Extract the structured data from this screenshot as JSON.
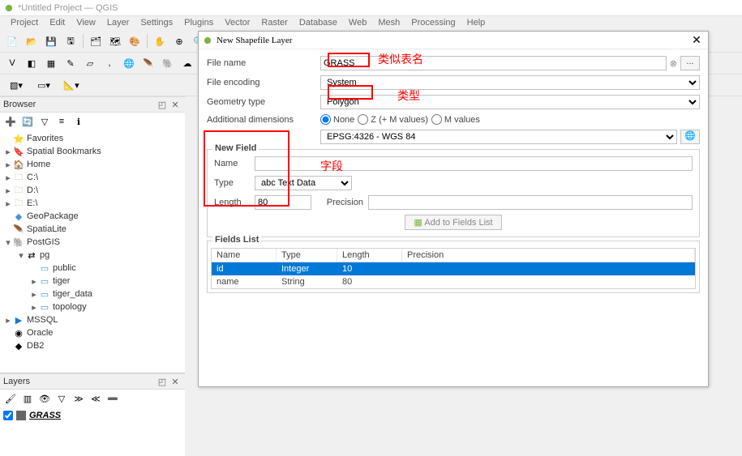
{
  "window_title": "*Untitled Project — QGIS",
  "menus": [
    "Project",
    "Edit",
    "View",
    "Layer",
    "Settings",
    "Plugins",
    "Vector",
    "Raster",
    "Database",
    "Web",
    "Mesh",
    "Processing",
    "Help"
  ],
  "browser": {
    "title": "Browser",
    "items": [
      {
        "indent": 0,
        "exp": "",
        "icon": "⭐",
        "cls": "ic-star",
        "label": "Favorites"
      },
      {
        "indent": 0,
        "exp": "▸",
        "icon": "🔖",
        "cls": "ic-book",
        "label": "Spatial Bookmarks"
      },
      {
        "indent": 0,
        "exp": "▸",
        "icon": "🏠",
        "cls": "",
        "label": "Home"
      },
      {
        "indent": 0,
        "exp": "▸",
        "icon": "🗀",
        "cls": "ic-folder",
        "label": "C:\\"
      },
      {
        "indent": 0,
        "exp": "▸",
        "icon": "🗀",
        "cls": "ic-folder",
        "label": "D:\\"
      },
      {
        "indent": 0,
        "exp": "▸",
        "icon": "🗀",
        "cls": "ic-folder",
        "label": "E:\\"
      },
      {
        "indent": 0,
        "exp": "",
        "icon": "◆",
        "cls": "ic-db",
        "label": "GeoPackage"
      },
      {
        "indent": 0,
        "exp": "",
        "icon": "🪶",
        "cls": "",
        "label": "SpatiaLite"
      },
      {
        "indent": 0,
        "exp": "▾",
        "icon": "🐘",
        "cls": "ic-pg",
        "label": "PostGIS"
      },
      {
        "indent": 1,
        "exp": "▾",
        "icon": "⇄",
        "cls": "",
        "label": "pg"
      },
      {
        "indent": 2,
        "exp": "",
        "icon": "▭",
        "cls": "ic-tbl",
        "label": "public"
      },
      {
        "indent": 2,
        "exp": "▸",
        "icon": "▭",
        "cls": "ic-tbl",
        "label": "tiger"
      },
      {
        "indent": 2,
        "exp": "▸",
        "icon": "▭",
        "cls": "ic-tbl",
        "label": "tiger_data"
      },
      {
        "indent": 2,
        "exp": "▸",
        "icon": "▭",
        "cls": "ic-tbl",
        "label": "topology"
      },
      {
        "indent": 0,
        "exp": "▸",
        "icon": "▶",
        "cls": "ic-mssql",
        "label": "MSSQL"
      },
      {
        "indent": 0,
        "exp": "",
        "icon": "◉",
        "cls": "",
        "label": "Oracle"
      },
      {
        "indent": 0,
        "exp": "",
        "icon": "◆",
        "cls": "",
        "label": "DB2"
      }
    ]
  },
  "layers": {
    "title": "Layers",
    "items": [
      {
        "checked": true,
        "name": "GRASS"
      }
    ]
  },
  "dialog": {
    "title": "New Shapefile Layer",
    "file_name_label": "File name",
    "file_name_value": "GRASS",
    "file_encoding_label": "File encoding",
    "file_encoding_value": "System",
    "geometry_type_label": "Geometry type",
    "geometry_type_value": "Polygon",
    "additional_dim_label": "Additional dimensions",
    "dim_none": "None",
    "dim_zm": "Z (+ M values)",
    "dim_m": "M values",
    "crs_value": "EPSG:4326 - WGS 84",
    "new_field": {
      "legend": "New Field",
      "name_label": "Name",
      "name_value": "",
      "type_label": "Type",
      "type_value": "abc Text Data",
      "length_label": "Length",
      "length_value": "80",
      "precision_label": "Precision",
      "precision_value": ""
    },
    "add_btn": "Add to Fields List",
    "fields_list": {
      "legend": "Fields List",
      "columns": [
        "Name",
        "Type",
        "Length",
        "Precision"
      ],
      "rows": [
        {
          "name": "id",
          "type": "Integer",
          "length": "10",
          "precision": "",
          "sel": true
        },
        {
          "name": "name",
          "type": "String",
          "length": "80",
          "precision": "",
          "sel": false
        }
      ]
    }
  },
  "annotations": {
    "a1": "类似表名",
    "a2": "类型",
    "a3": "字段"
  }
}
